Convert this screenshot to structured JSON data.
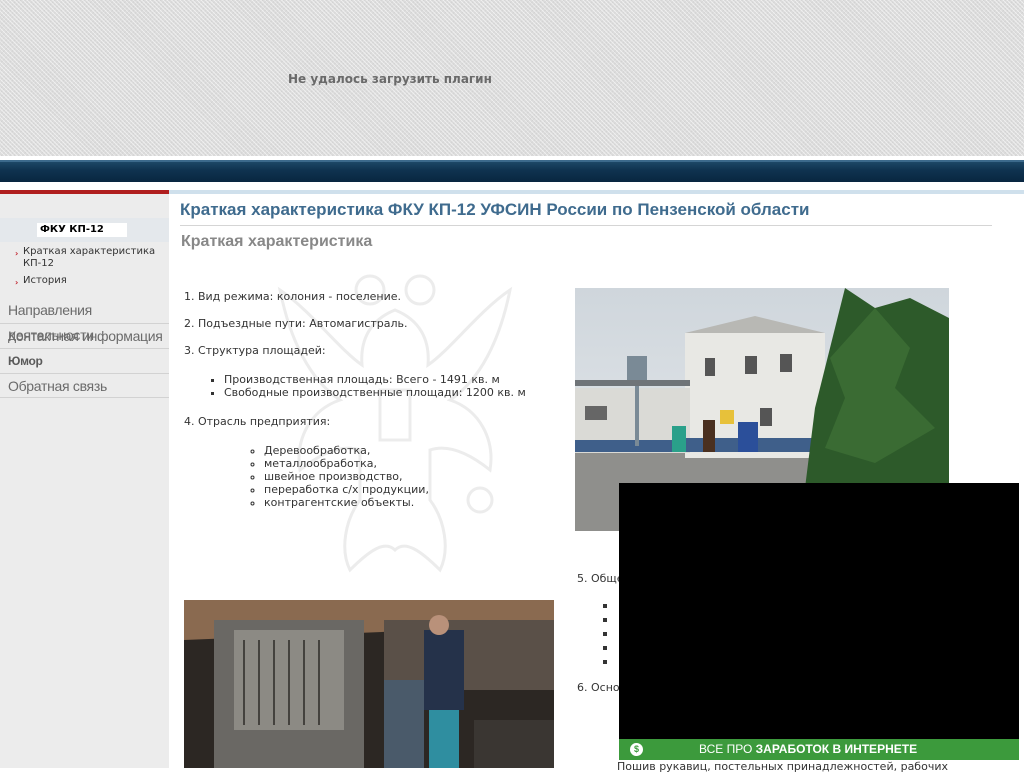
{
  "header": {
    "plugin_message": "Не удалось загрузить плагин"
  },
  "sidebar": {
    "logo_text": "ФКУ КП-12",
    "submenu": [
      {
        "label": "Краткая характеристика КП-12"
      },
      {
        "label": "История"
      }
    ],
    "nav": [
      {
        "label": "Направления деятельности"
      },
      {
        "label": "Контактная информация"
      },
      {
        "label": "Юмор"
      },
      {
        "label": "Обратная связь"
      }
    ]
  },
  "main": {
    "title": "Краткая характеристика ФКУ КП-12 УФСИН России по Пензенской области",
    "subtitle": "Краткая характеристика",
    "items": {
      "i1": "1. Вид режима: колония - поселение.",
      "i2": "2. Подъездные пути: Автомагистраль.",
      "i3": "3. Структура площадей:",
      "areas": [
        "Производственная площадь: Всего - 1491 кв. м",
        "Свободные производственные площади: 1200 кв. м"
      ],
      "i4": "4. Отрасль предприятия:",
      "branches": [
        "Деревообработка,",
        "металлообработка,",
        "швейное производство,",
        "переработка с/х продукции,",
        "контрагентские объекты."
      ],
      "i5": "5. Обще",
      "i6": "6. Осно",
      "bottom_fragment": "Пошив рукавиц, постельных принадлежностей, рабочих"
    }
  },
  "ad": {
    "icon_glyph": "$",
    "text_light": "ВСЕ ПРО ",
    "text_bold": "ЗАРАБОТОК В ИНТЕРНЕТЕ",
    "bar_color": "#3c9a3c"
  }
}
